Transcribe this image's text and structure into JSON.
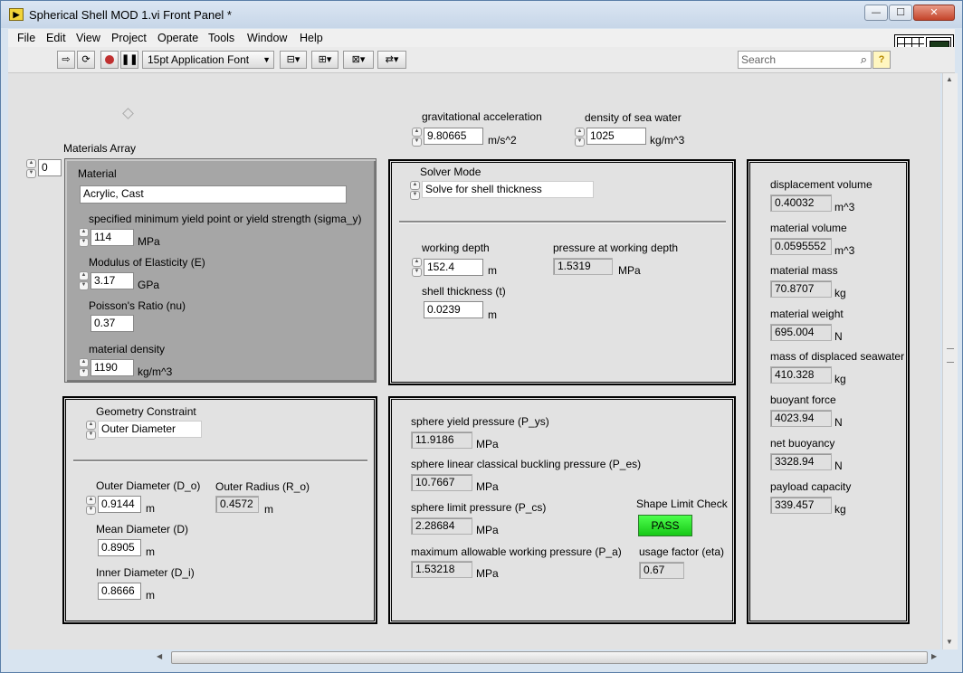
{
  "window": {
    "title": "Spherical Shell MOD 1.vi Front Panel *",
    "minimize_label": "—",
    "maximize_label": "☐",
    "close_label": "✕"
  },
  "menu": [
    "File",
    "Edit",
    "View",
    "Project",
    "Operate",
    "Tools",
    "Window",
    "Help"
  ],
  "toolbar": {
    "font_label": "15pt Application Font",
    "search_placeholder": "Search"
  },
  "materials": {
    "array_label": "Materials Array",
    "index": "0",
    "cluster_label": "Material",
    "material_name": "Acrylic, Cast",
    "yield_label": "specified minimum yield point or yield strength (sigma_y)",
    "yield_value": "114",
    "yield_unit": "MPa",
    "modulus_label": "Modulus of Elasticity (E)",
    "modulus_value": "3.17",
    "modulus_unit": "GPa",
    "poisson_label": "Poisson's Ratio (nu)",
    "poisson_value": "0.37",
    "density_label": "material density",
    "density_value": "1190",
    "density_unit": "kg/m^3"
  },
  "environment": {
    "gravity_label": "gravitational acceleration",
    "gravity_value": "9.80665",
    "gravity_unit": "m/s^2",
    "seawater_label": "density of sea water",
    "seawater_value": "1025",
    "seawater_unit": "kg/m^3"
  },
  "solver": {
    "mode_label": "Solver Mode",
    "mode_value": "Solve for shell thickness",
    "depth_label": "working depth",
    "depth_value": "152.4",
    "depth_unit": "m",
    "pressure_label": "pressure at working depth",
    "pressure_value": "1.5319",
    "pressure_unit": "MPa",
    "thickness_label": "shell thickness (t)",
    "thickness_value": "0.0239",
    "thickness_unit": "m"
  },
  "geometry": {
    "constraint_label": "Geometry Constraint",
    "constraint_value": "Outer Diameter",
    "outer_diameter_label": "Outer Diameter (D_o)",
    "outer_diameter_value": "0.9144",
    "outer_radius_label": "Outer Radius (R_o)",
    "outer_radius_value": "0.4572",
    "mean_diameter_label": "Mean Diameter (D)",
    "mean_diameter_value": "0.8905",
    "inner_diameter_label": "Inner Diameter (D_i)",
    "inner_diameter_value": "0.8666",
    "unit": "m"
  },
  "pressures": {
    "yield_label": "sphere yield pressure (P_ys)",
    "yield_value": "11.9186",
    "buckling_label": "sphere linear classical buckling pressure (P_es)",
    "buckling_value": "10.7667",
    "limit_label": "sphere limit pressure (P_cs)",
    "limit_value": "2.28684",
    "allowable_label": "maximum allowable working pressure (P_a)",
    "allowable_value": "1.53218",
    "unit": "MPa",
    "shape_check_label": "Shape Limit Check",
    "shape_check_value": "PASS",
    "usage_label": "usage factor (eta)",
    "usage_value": "0.67"
  },
  "results": {
    "displacement_volume_label": "displacement volume",
    "displacement_volume_value": "0.40032",
    "material_volume_label": "material volume",
    "material_volume_value": "0.0595552",
    "volume_unit": "m^3",
    "material_mass_label": "material mass",
    "material_mass_value": "70.8707",
    "material_weight_label": "material weight",
    "material_weight_value": "695.004",
    "displaced_mass_label": "mass of displaced seawater",
    "displaced_mass_value": "410.328",
    "buoyant_force_label": "buoyant force",
    "buoyant_force_value": "4023.94",
    "net_buoyancy_label": "net buoyancy",
    "net_buoyancy_value": "3328.94",
    "payload_label": "payload capacity",
    "payload_value": "339.457",
    "mass_unit": "kg",
    "force_unit": "N"
  },
  "colors": {
    "panel_bg": "#e2e2e2",
    "pass_green": "#22dd22",
    "cluster_gray": "#a6a6a6"
  }
}
